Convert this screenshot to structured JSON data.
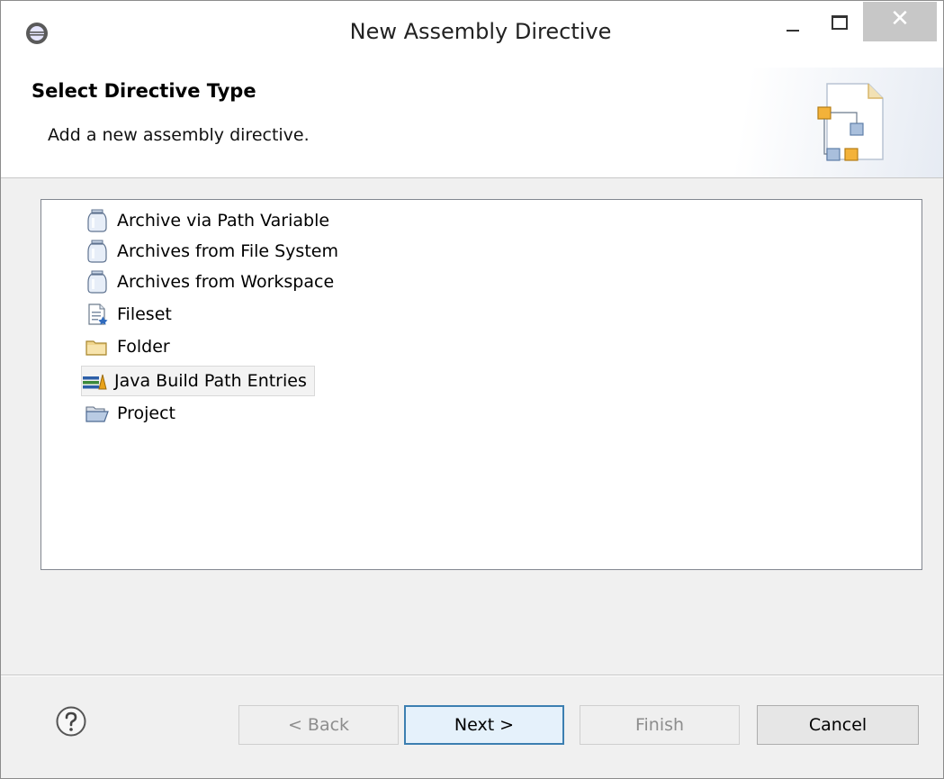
{
  "window": {
    "title": "New Assembly Directive",
    "close_glyph": "✕",
    "icons": {
      "app": "eclipse-icon",
      "minimize": "minimize-icon",
      "maximize": "maximize-icon",
      "close": "close-icon"
    }
  },
  "header": {
    "title": "Select Directive Type",
    "description": "Add a new assembly directive.",
    "icon": "wizard-banner-icon"
  },
  "directive_list": {
    "items": [
      {
        "label": "Archive via Path Variable",
        "icon": "jar-icon",
        "selected": false
      },
      {
        "label": "Archives from File System",
        "icon": "jar-icon",
        "selected": false
      },
      {
        "label": "Archives from Workspace",
        "icon": "jar-icon",
        "selected": false
      },
      {
        "label": "Fileset",
        "icon": "fileset-icon",
        "selected": false
      },
      {
        "label": "Folder",
        "icon": "folder-icon",
        "selected": false
      },
      {
        "label": "Java Build Path Entries",
        "icon": "library-icon",
        "selected": true
      },
      {
        "label": "Project",
        "icon": "open-folder-icon",
        "selected": false
      }
    ]
  },
  "buttons": {
    "help_icon": "help-icon",
    "back": "< Back",
    "next": "Next >",
    "finish": "Finish",
    "cancel": "Cancel"
  },
  "colors": {
    "close_button": "#c7c7c7",
    "default_button_border": "#3c7fb1",
    "folder": "#f0d58c"
  }
}
